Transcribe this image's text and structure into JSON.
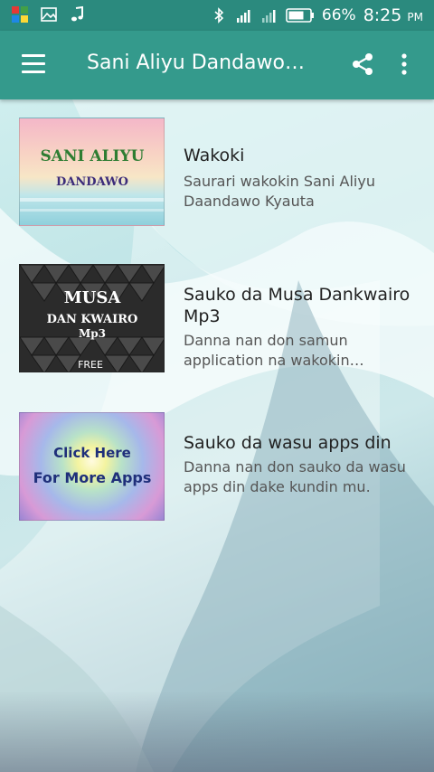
{
  "status_bar": {
    "battery_percent": "66%",
    "time": "8:25",
    "ampm": "PM"
  },
  "app_bar": {
    "title": "Sani Aliyu Dandawo…"
  },
  "items": [
    {
      "title": "Wakoki",
      "subtitle": "Saurari wakokin Sani Aliyu Daandawo Kyauta",
      "thumb": {
        "line1": "SANI ALIYU",
        "line2": "DANDAWO"
      }
    },
    {
      "title": "Sauko da Musa Dankwairo Mp3",
      "subtitle": "Danna nan don samun application na wakokin…",
      "thumb": {
        "line1": "MUSA",
        "line2": "DAN KWAIRO",
        "line3": "Mp3",
        "badge": "FREE"
      }
    },
    {
      "title": "Sauko da wasu apps din",
      "subtitle": "Danna nan don sauko da wasu apps din dake kundin mu.",
      "thumb": {
        "line1": "Click Here",
        "line2": "For More Apps"
      }
    }
  ],
  "colors": {
    "status_bar": "#2b8a7e",
    "app_bar": "#349a8c"
  }
}
